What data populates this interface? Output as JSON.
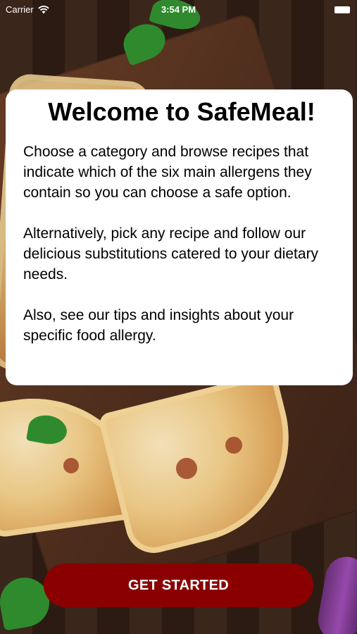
{
  "status_bar": {
    "carrier": "Carrier",
    "time": "3:54 PM",
    "wifi_icon": "wifi-icon",
    "battery_icon": "battery-icon"
  },
  "welcome": {
    "title": "Welcome to SafeMeal!",
    "paragraphs": [
      "Choose a category and browse recipes that indicate which of the six main allergens they contain so you can choose a safe option.",
      "Alternatively, pick any recipe and follow our delicious substitutions catered to your dietary needs.",
      "Also, see our tips and insights about your specific food allergy."
    ]
  },
  "cta": {
    "label": "GET STARTED"
  },
  "colors": {
    "cta_background": "#8a0000",
    "card_background": "#ffffff",
    "text_primary": "#000000"
  }
}
